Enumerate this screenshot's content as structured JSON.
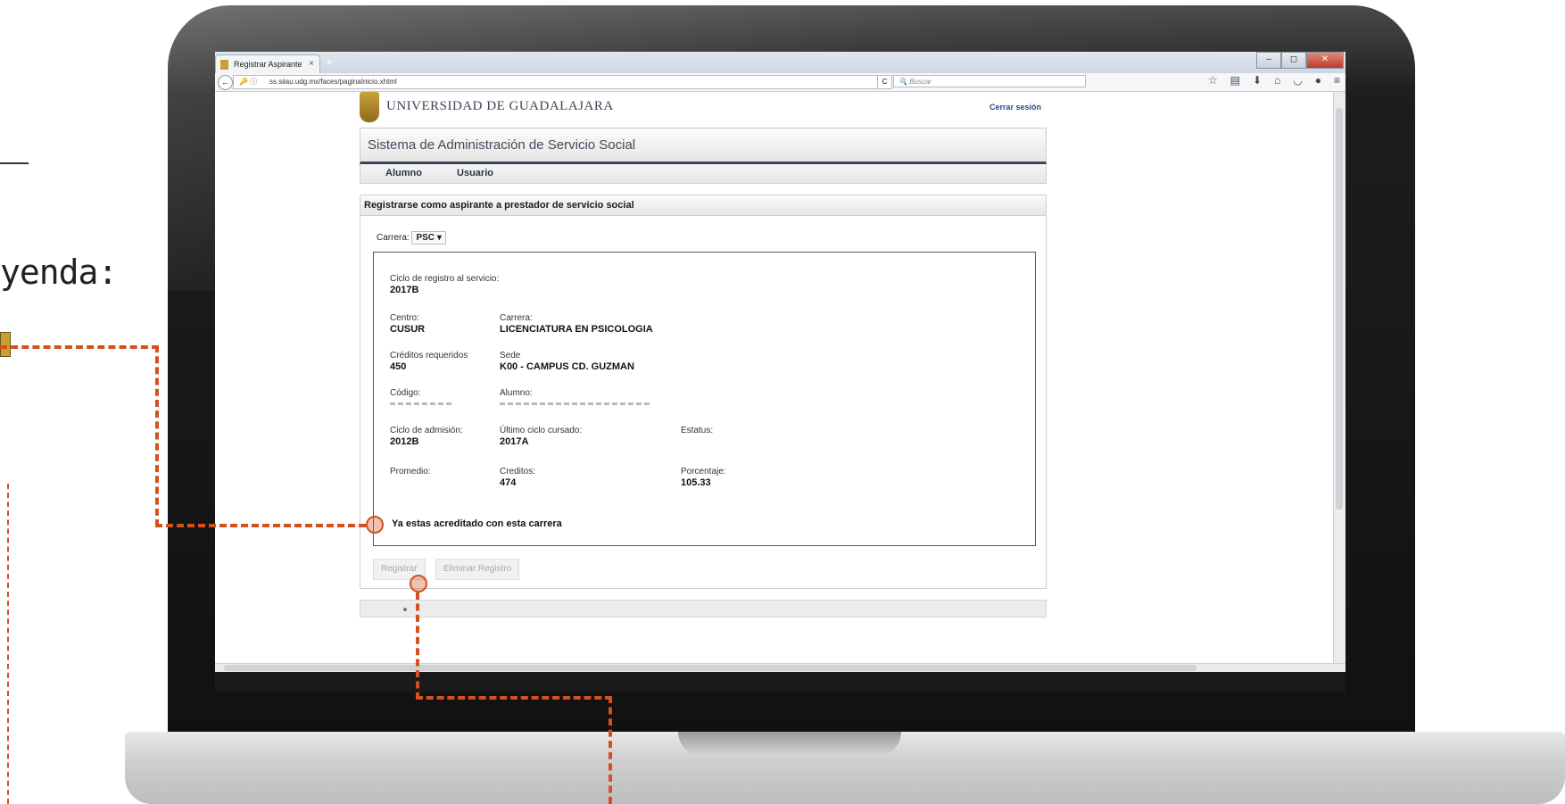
{
  "slide": {
    "caption": "yenda:"
  },
  "browser": {
    "tab_title": "Registrar Aspirante",
    "tab_close": "×",
    "new_tab": "+",
    "url": "ss.siiau.udg.mx/faces/paginaInicio.xhtml",
    "search_placeholder": "Buscar",
    "reload": "C",
    "back": "←"
  },
  "header": {
    "institution": "UNIVERSIDAD DE GUADALAJARA",
    "logout": "Cerrar sesión",
    "system_title": "Sistema de Administración de Servicio Social"
  },
  "menu": {
    "items": [
      "Alumno",
      "Usuario"
    ]
  },
  "panel": {
    "title": "Registrarse como aspirante a prestador de servicio social",
    "carrera_label": "Carrera:",
    "carrera_value": "PSC",
    "ciclo_registro_label": "Ciclo de registro al servicio:",
    "ciclo_registro_value": "2017B",
    "centro_label": "Centro:",
    "centro_value": "CUSUR",
    "carrera2_label": "Carrera:",
    "carrera2_value": "LICENCIATURA EN PSICOLOGIA",
    "creditos_req_label": "Créditos requeridos",
    "creditos_req_value": "450",
    "sede_label": "Sede",
    "sede_value": "K00 - CAMPUS CD. GUZMAN",
    "codigo_label": "Código:",
    "alumno_label": "Alumno:",
    "ciclo_admision_label": "Ciclo de admisión:",
    "ciclo_admision_value": "2012B",
    "ultimo_ciclo_label": "Último ciclo cursado:",
    "ultimo_ciclo_value": "2017A",
    "estatus_label": "Estatus:",
    "promedio_label": "Promedio:",
    "creditos_label": "Creditos:",
    "creditos_value": "474",
    "porcentaje_label": "Porcentaje:",
    "porcentaje_value": "105.33",
    "alert": "Ya estas acreditado con esta carrera",
    "register_button": "Registrar",
    "delete_button": "Eliminar Registro"
  },
  "colors": {
    "callout": "#d4501e",
    "brand_dark": "#3d4556",
    "link": "#1e4f8a"
  }
}
